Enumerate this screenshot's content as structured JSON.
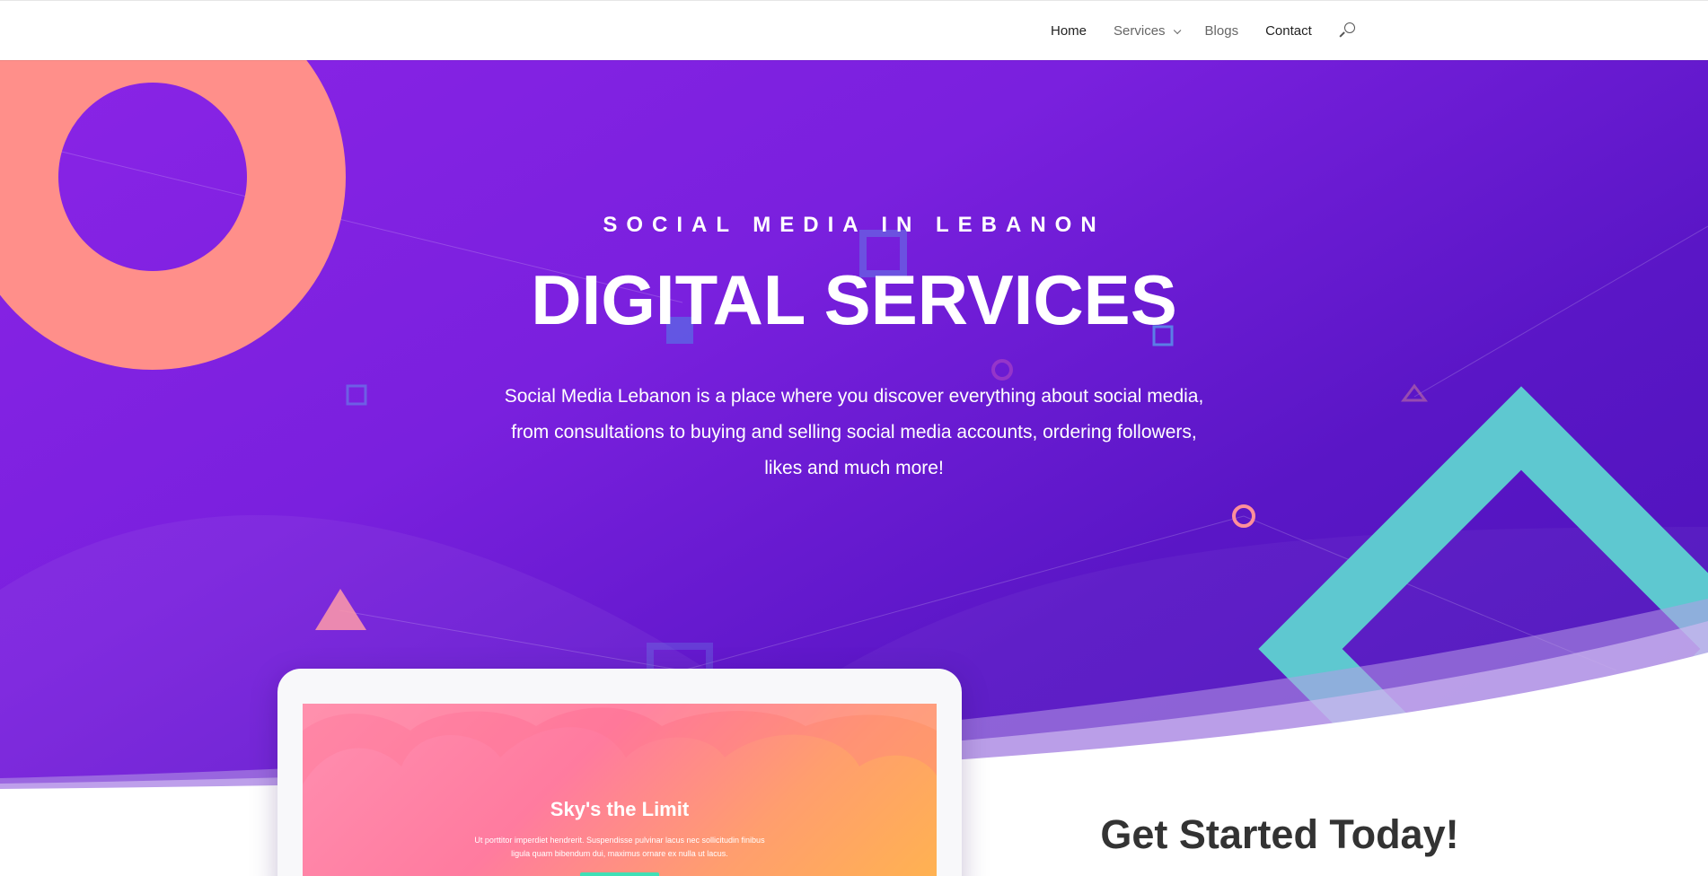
{
  "nav": {
    "items": [
      {
        "label": "Home"
      },
      {
        "label": "Services"
      },
      {
        "label": "Blogs"
      },
      {
        "label": "Contact"
      }
    ],
    "search_icon": "search-icon"
  },
  "hero": {
    "subtitle": "SOCIAL MEDIA IN LEBANON",
    "title": "DIGITAL SERVICES",
    "description": "Social Media Lebanon is a place where you discover everything about social media, from consultations to buying and selling social media accounts, ordering followers, likes and much more!"
  },
  "mockup": {
    "title": "Sky's the Limit",
    "text": "Ut porttitor imperdiet hendrerit. Suspendisse pulvinar lacus nec sollicitudin finibus ligula quam bibendum dui, maximus ornare ex nulla ut lacus."
  },
  "cta": {
    "title": "Get Started Today!"
  },
  "colors": {
    "hero_gradient_start": "#8a24e6",
    "hero_gradient_end": "#4a12b8",
    "ring_coral": "#ff8f8a",
    "diamond_teal": "#5ec8d0",
    "button_mint": "#3fe0b6",
    "heading_dark": "#333333"
  }
}
